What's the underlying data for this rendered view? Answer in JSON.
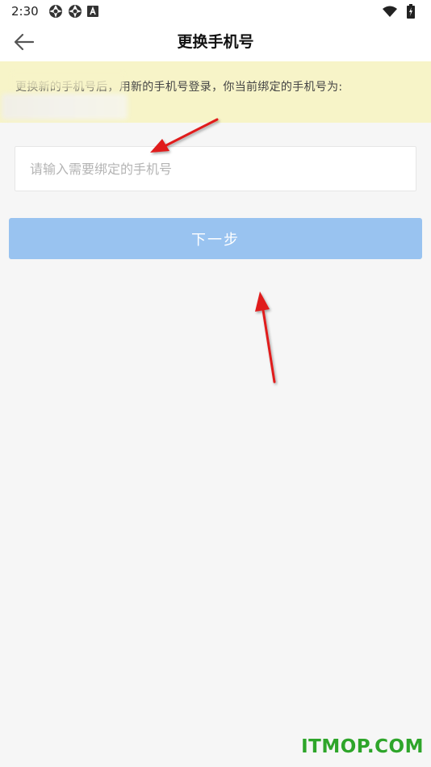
{
  "status_bar": {
    "time": "2:30",
    "left_icons": [
      "aperture-icon",
      "aperture-icon",
      "font-a-icon"
    ],
    "right_icons": [
      "wifi-icon",
      "battery-charging-icon"
    ]
  },
  "header": {
    "title": "更换手机号",
    "back_icon": "arrow-left-icon"
  },
  "notice": {
    "text": "更换新的手机号后，用新的手机号登录，你当前绑定的手机号为:",
    "phone_redacted": true,
    "background": "#f7f4c8"
  },
  "form": {
    "phone_input": {
      "value": "",
      "placeholder": "请输入需要绑定的手机号"
    },
    "next_button_label": "下一步",
    "button_color": "#99c3f0"
  },
  "annotations": {
    "color": "#e01e1e",
    "arrows": [
      "points-to-phone-input",
      "points-to-next-button"
    ]
  },
  "watermark": {
    "text": "ITMOP.COM",
    "color": "#2ea52a"
  }
}
